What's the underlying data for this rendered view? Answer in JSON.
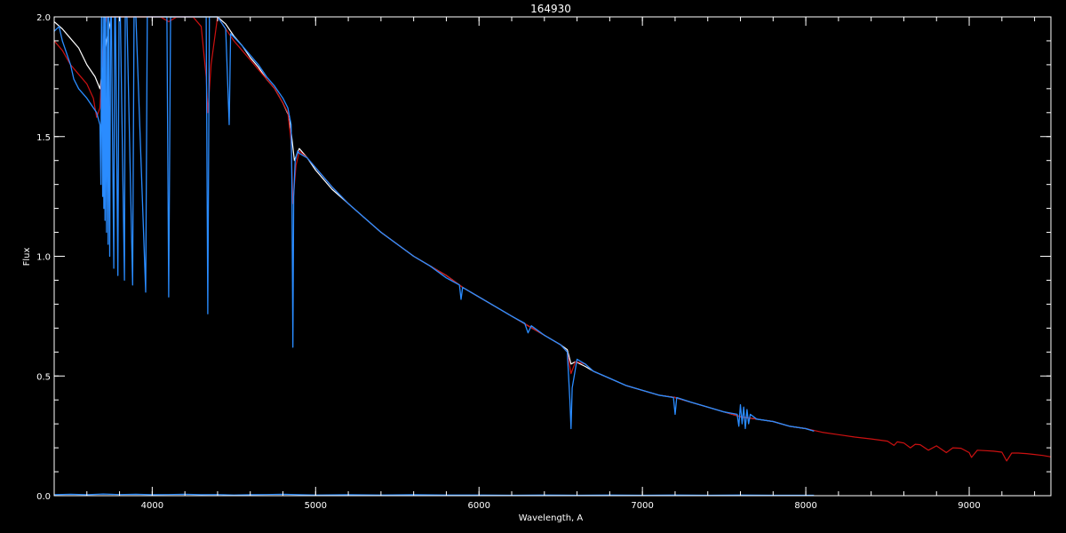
{
  "chart_data": {
    "type": "line",
    "title": "164930",
    "xlabel": "Wavelength, A",
    "ylabel": "Flux",
    "xlim": [
      3400,
      9500
    ],
    "ylim": [
      0.0,
      2.0
    ],
    "grid": false,
    "background": "#000000",
    "axis_color": "#ffffff",
    "x_ticks": [
      4000,
      5000,
      6000,
      7000,
      8000,
      9000
    ],
    "x_tick_labels": [
      "4000",
      "5000",
      "6000",
      "7000",
      "8000",
      "9000"
    ],
    "y_ticks": [
      0.0,
      0.5,
      1.0,
      1.5,
      2.0
    ],
    "y_tick_labels": [
      "0.0",
      "0.5",
      "1.0",
      "1.5",
      "2.0"
    ],
    "x_minor_step": 200,
    "y_minor_step": 0.1,
    "series": [
      {
        "color": "#ffffff",
        "x": [
          3400,
          3450,
          3500,
          3550,
          3600,
          3650,
          3680,
          3720,
          3750,
          3800,
          3850,
          3900,
          3950,
          4000,
          4050,
          4100,
          4150,
          4200,
          4250,
          4300,
          4350,
          4400,
          4450,
          4500,
          4550,
          4600,
          4650,
          4700,
          4750,
          4800,
          4840,
          4870,
          4900,
          4950,
          5000,
          5100,
          5200,
          5300,
          5400,
          5500,
          5600,
          5700,
          5800,
          5900,
          6000,
          6100,
          6200,
          6300,
          6400,
          6500,
          6540,
          6563,
          6590,
          6650,
          6700,
          6800,
          6900,
          7000,
          7100,
          7200,
          7300,
          7400,
          7500,
          7600,
          7700,
          7800,
          7900,
          8000,
          8050
        ],
        "y": [
          1.98,
          1.95,
          1.91,
          1.87,
          1.8,
          1.75,
          1.7,
          1.9,
          2.0,
          2.0,
          2.0,
          2.0,
          2.0,
          2.0,
          2.0,
          2.0,
          2.0,
          2.0,
          2.0,
          2.0,
          2.0,
          2.0,
          1.97,
          1.92,
          1.88,
          1.83,
          1.79,
          1.74,
          1.7,
          1.64,
          1.58,
          1.4,
          1.45,
          1.41,
          1.36,
          1.28,
          1.22,
          1.16,
          1.1,
          1.05,
          1.0,
          0.96,
          0.92,
          0.87,
          0.83,
          0.79,
          0.75,
          0.71,
          0.67,
          0.63,
          0.61,
          0.55,
          0.56,
          0.54,
          0.52,
          0.49,
          0.46,
          0.44,
          0.42,
          0.41,
          0.39,
          0.37,
          0.35,
          0.33,
          0.32,
          0.31,
          0.29,
          0.28,
          0.27
        ]
      },
      {
        "color": "#cc1111",
        "x": [
          3400,
          3450,
          3500,
          3550,
          3600,
          3640,
          3660,
          3680,
          3700,
          3720,
          3760,
          3800,
          3850,
          3900,
          4000,
          4050,
          4101,
          4150,
          4200,
          4250,
          4300,
          4330,
          4340,
          4360,
          4400,
          4450,
          4500,
          4550,
          4600,
          4650,
          4700,
          4750,
          4800,
          4830,
          4850,
          4861,
          4880,
          4900,
          4950,
          5000,
          5100,
          5200,
          5300,
          5400,
          5500,
          5600,
          5700,
          5800,
          5900,
          6000,
          6100,
          6200,
          6300,
          6400,
          6500,
          6540,
          6563,
          6590,
          6650,
          6700,
          6800,
          6900,
          7000,
          7100,
          7200,
          7300,
          7400,
          7500,
          7600,
          7700,
          7800,
          7900,
          8000,
          8100,
          8200,
          8300,
          8400,
          8500,
          8540,
          8560,
          8600,
          8640,
          8670,
          8700,
          8750,
          8800,
          8860,
          8900,
          8950,
          9000,
          9014,
          9050,
          9100,
          9150,
          9200,
          9229,
          9260,
          9300,
          9350,
          9400,
          9450,
          9500
        ],
        "y": [
          1.9,
          1.86,
          1.8,
          1.76,
          1.72,
          1.66,
          1.58,
          1.62,
          1.9,
          2.0,
          2.0,
          2.0,
          2.0,
          2.0,
          2.0,
          2.0,
          1.98,
          2.0,
          2.0,
          2.0,
          1.96,
          1.75,
          1.6,
          1.8,
          2.0,
          1.95,
          1.9,
          1.86,
          1.82,
          1.78,
          1.74,
          1.7,
          1.64,
          1.6,
          1.48,
          1.22,
          1.38,
          1.44,
          1.41,
          1.37,
          1.29,
          1.22,
          1.16,
          1.1,
          1.05,
          1.0,
          0.96,
          0.92,
          0.87,
          0.83,
          0.79,
          0.75,
          0.71,
          0.67,
          0.63,
          0.6,
          0.51,
          0.56,
          0.55,
          0.52,
          0.49,
          0.46,
          0.44,
          0.42,
          0.41,
          0.39,
          0.37,
          0.35,
          0.33,
          0.32,
          0.31,
          0.29,
          0.28,
          0.265,
          0.255,
          0.245,
          0.237,
          0.228,
          0.21,
          0.225,
          0.22,
          0.2,
          0.215,
          0.213,
          0.19,
          0.208,
          0.18,
          0.2,
          0.198,
          0.18,
          0.16,
          0.19,
          0.188,
          0.186,
          0.182,
          0.145,
          0.178,
          0.178,
          0.176,
          0.172,
          0.168,
          0.162
        ]
      },
      {
        "color": "#2a8cff",
        "x": [
          3400,
          3430,
          3450,
          3480,
          3500,
          3520,
          3550,
          3600,
          3640,
          3660,
          3680,
          3686,
          3690,
          3697,
          3700,
          3704,
          3708,
          3711,
          3715,
          3720,
          3726,
          3730,
          3734,
          3740,
          3745,
          3750,
          3765,
          3770,
          3775,
          3790,
          3797,
          3805,
          3830,
          3835,
          3845,
          3880,
          3889,
          3900,
          3960,
          3970,
          3980,
          4090,
          4101,
          4112,
          4200,
          4280,
          4330,
          4340,
          4350,
          4400,
          4450,
          4471,
          4480,
          4550,
          4650,
          4700,
          4750,
          4800,
          4830,
          4850,
          4855,
          4861,
          4866,
          4875,
          4890,
          4900,
          4950,
          5000,
          5100,
          5200,
          5300,
          5400,
          5500,
          5600,
          5700,
          5800,
          5880,
          5890,
          5900,
          5950,
          6000,
          6100,
          6200,
          6280,
          6300,
          6320,
          6400,
          6500,
          6540,
          6556,
          6563,
          6570,
          6600,
          6650,
          6700,
          6800,
          6900,
          7000,
          7100,
          7190,
          7200,
          7210,
          7300,
          7400,
          7500,
          7580,
          7590,
          7600,
          7610,
          7620,
          7630,
          7640,
          7650,
          7660,
          7700,
          7800,
          7900,
          8000,
          8050
        ],
        "y": [
          1.94,
          1.96,
          1.9,
          1.84,
          1.8,
          1.74,
          1.7,
          1.66,
          1.62,
          1.6,
          1.55,
          1.3,
          2.0,
          1.25,
          2.0,
          1.2,
          2.0,
          1.15,
          2.0,
          1.1,
          2.0,
          1.05,
          2.0,
          1.0,
          2.0,
          2.0,
          0.95,
          2.0,
          2.0,
          0.92,
          2.0,
          2.0,
          0.9,
          2.0,
          2.0,
          0.88,
          2.0,
          2.0,
          0.85,
          2.0,
          2.0,
          2.0,
          0.83,
          2.0,
          2.0,
          2.0,
          2.0,
          0.76,
          2.0,
          2.0,
          1.95,
          1.55,
          1.93,
          1.88,
          1.8,
          1.75,
          1.71,
          1.66,
          1.62,
          1.55,
          1.3,
          0.62,
          1.25,
          1.4,
          1.44,
          1.43,
          1.41,
          1.37,
          1.29,
          1.22,
          1.16,
          1.1,
          1.05,
          1.0,
          0.96,
          0.91,
          0.88,
          0.82,
          0.87,
          0.85,
          0.83,
          0.79,
          0.75,
          0.72,
          0.68,
          0.71,
          0.67,
          0.63,
          0.6,
          0.4,
          0.28,
          0.45,
          0.57,
          0.55,
          0.52,
          0.49,
          0.46,
          0.44,
          0.42,
          0.41,
          0.34,
          0.41,
          0.39,
          0.37,
          0.35,
          0.34,
          0.29,
          0.38,
          0.3,
          0.37,
          0.28,
          0.36,
          0.3,
          0.34,
          0.32,
          0.31,
          0.29,
          0.28,
          0.27
        ]
      },
      {
        "color": "#2a8cff",
        "x": [
          3400,
          3500,
          3600,
          3700,
          3800,
          3900,
          4000,
          4100,
          4200,
          4300,
          4400,
          4500,
          4600,
          4700,
          4800,
          4900,
          5000,
          5200,
          5400,
          5600,
          5800,
          6000,
          6200,
          6400,
          6600,
          6800,
          7000,
          7200,
          7400,
          7600,
          7800,
          8000,
          8050
        ],
        "y": [
          0.004,
          0.006,
          0.004,
          0.007,
          0.005,
          0.006,
          0.004,
          0.005,
          0.006,
          0.004,
          0.005,
          0.003,
          0.004,
          0.005,
          0.006,
          0.004,
          0.003,
          0.004,
          0.003,
          0.004,
          0.003,
          0.003,
          0.002,
          0.003,
          0.002,
          0.003,
          0.002,
          0.003,
          0.002,
          0.003,
          0.002,
          0.002,
          0.002
        ]
      }
    ]
  }
}
